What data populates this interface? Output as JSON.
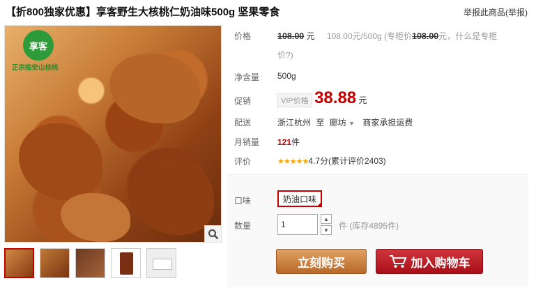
{
  "header": {
    "title": "【折800独家优惠】享客野生大核桃仁奶油味500g 坚果零食",
    "report": "举报此商品(举报)"
  },
  "gallery": {
    "logo_text": "享客",
    "logo_tag": "正宗临安山核桃",
    "thumbnails": [
      "thumb-1",
      "thumb-2",
      "thumb-3",
      "thumb-4",
      "thumb-5"
    ]
  },
  "details": {
    "price_label": "价格",
    "price_value": "108.00",
    "price_unit": "元",
    "unit_price_text": "108.00元/500g",
    "counter_prefix": "(专柜价",
    "counter_price": "108.00",
    "counter_suffix": "元，什么是专柜",
    "counter_line2": "价?)",
    "weight_label": "净含量",
    "weight_value": "500g",
    "promo_label": "促销",
    "vip_badge": "VIP价格",
    "promo_price": "38.88",
    "promo_unit": "元",
    "shipping_label": "配送",
    "ship_from": "浙江杭州",
    "ship_to_word": "至",
    "ship_to": "廊坊",
    "shipping_note": "商家承担运费",
    "sales_label": "月销量",
    "sales_value": "121",
    "sales_unit": "件",
    "rating_label": "评价",
    "rating_stars": "★★★★★",
    "rating_text": "4.7分(累计评价2403)"
  },
  "options": {
    "flavor_label": "口味",
    "flavor_value": "奶油口味",
    "qty_label": "数量",
    "qty_value": "1",
    "stock_text": "件 (库存4895件)",
    "buy_label": "立刻购买",
    "cart_label": "加入购物车"
  },
  "colors": {
    "accent_red": "#c40000",
    "buy_button": "#c67a3a",
    "cart_button": "#b81c24"
  }
}
